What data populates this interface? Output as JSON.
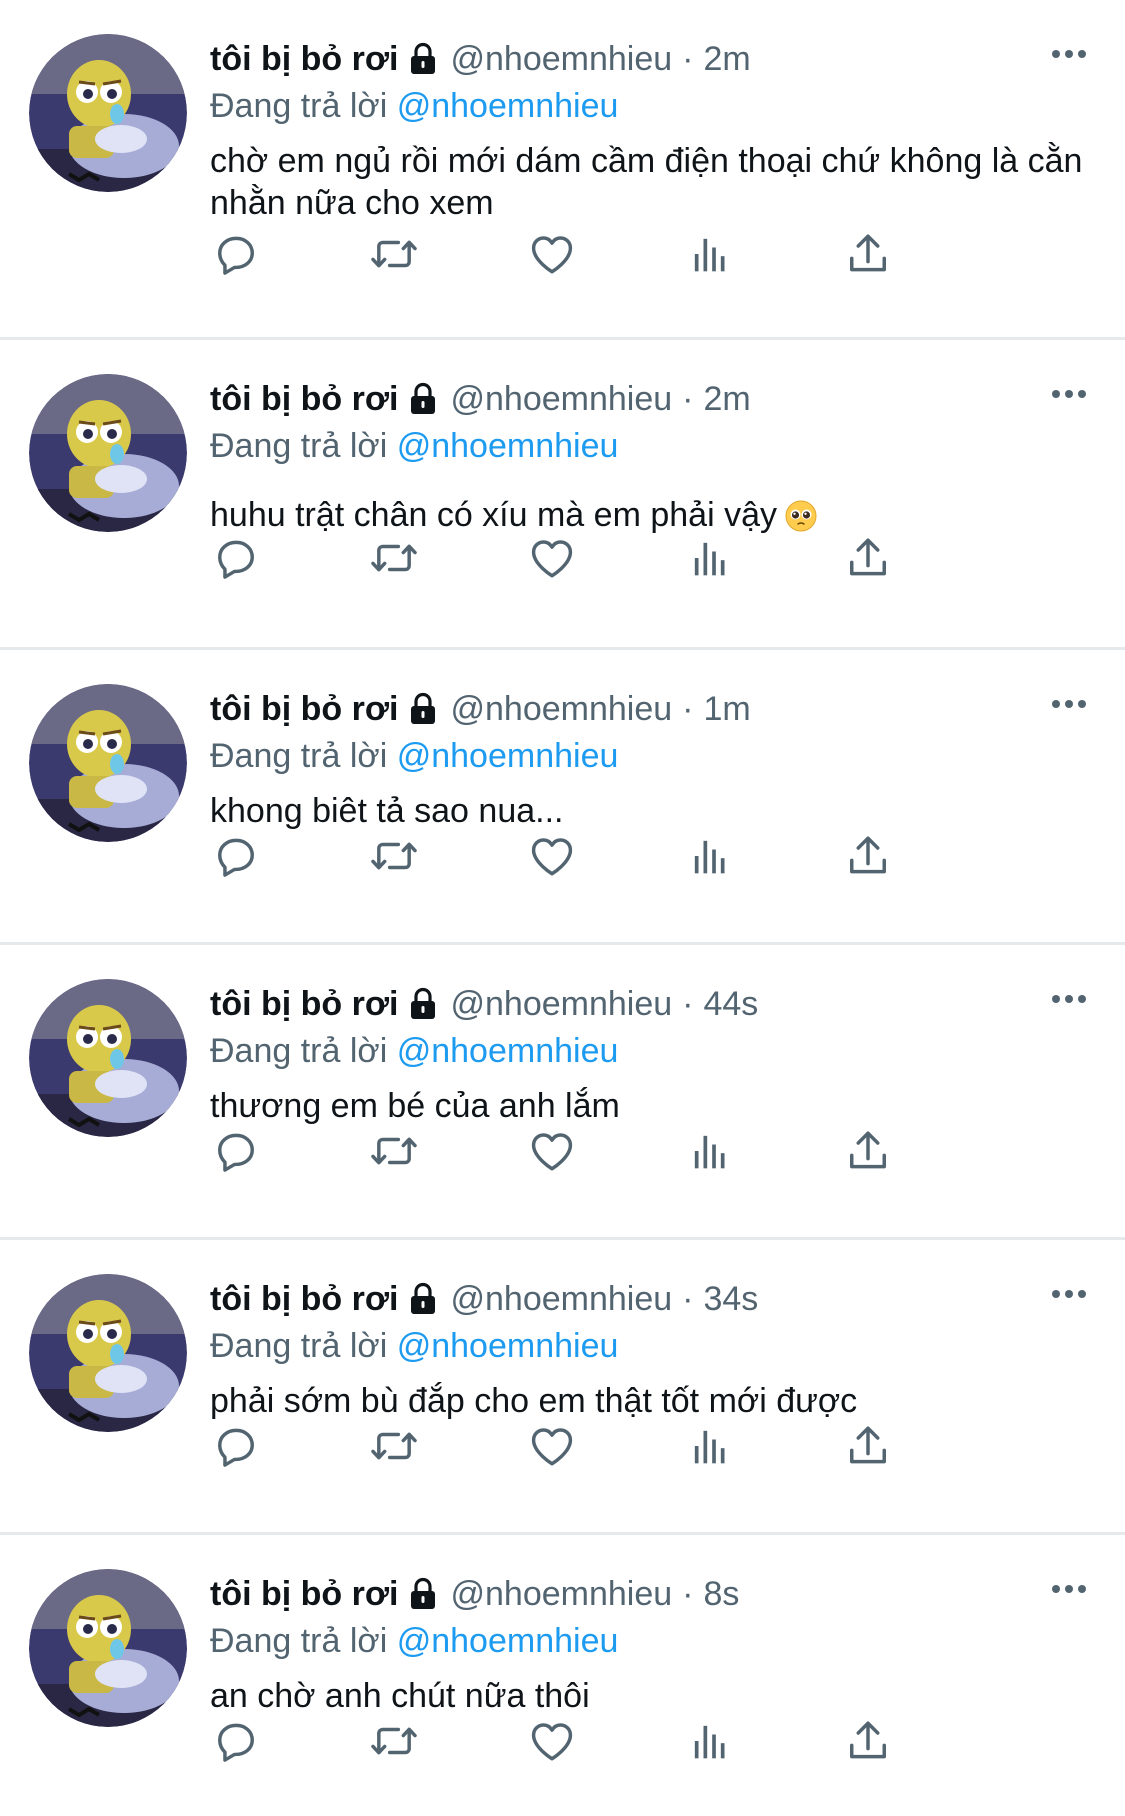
{
  "tweets": [
    {
      "author": "tôi bị bỏ rơi",
      "handle": "@nhoemnhieu",
      "separator": "·",
      "time": "2m",
      "reply_prefix": "Đang trả lời",
      "reply_to": "@nhoemnhieu",
      "text": "chờ em ngủ rồi mới dám cầm điện thoại chứ không là cằn nhằn nữa cho xem",
      "emoji": ""
    },
    {
      "author": "tôi bị bỏ rơi",
      "handle": "@nhoemnhieu",
      "separator": "·",
      "time": "2m",
      "reply_prefix": "Đang trả lời",
      "reply_to": "@nhoemnhieu",
      "text": "huhu trật chân có xíu mà em phải vậy",
      "emoji": "pleading-face"
    },
    {
      "author": "tôi bị bỏ rơi",
      "handle": "@nhoemnhieu",
      "separator": "·",
      "time": "1m",
      "reply_prefix": "Đang trả lời",
      "reply_to": "@nhoemnhieu",
      "text": "khong biêt tả sao nua...",
      "emoji": ""
    },
    {
      "author": "tôi bị bỏ rơi",
      "handle": "@nhoemnhieu",
      "separator": "·",
      "time": "44s",
      "reply_prefix": "Đang trả lời",
      "reply_to": "@nhoemnhieu",
      "text": "thương em bé của anh lắm",
      "emoji": ""
    },
    {
      "author": "tôi bị bỏ rơi",
      "handle": "@nhoemnhieu",
      "separator": "·",
      "time": "34s",
      "reply_prefix": "Đang trả lời",
      "reply_to": "@nhoemnhieu",
      "text": "phải sớm bù đắp cho em thật tốt mới được",
      "emoji": ""
    },
    {
      "author": "tôi bị bỏ rơi",
      "handle": "@nhoemnhieu",
      "separator": "·",
      "time": "8s",
      "reply_prefix": "Đang trả lời",
      "reply_to": "@nhoemnhieu",
      "text": "an chờ anh chút nữa thôi",
      "emoji": ""
    }
  ],
  "icons": {
    "account": "lock-icon",
    "more": "more-options-icon",
    "actions": [
      "reply-icon",
      "retweet-icon",
      "like-icon",
      "analytics-icon",
      "share-icon"
    ]
  },
  "colors": {
    "text": "#0f1419",
    "secondary": "#536471",
    "mention": "#1d9bf0",
    "divider": "#e6e9eb"
  }
}
